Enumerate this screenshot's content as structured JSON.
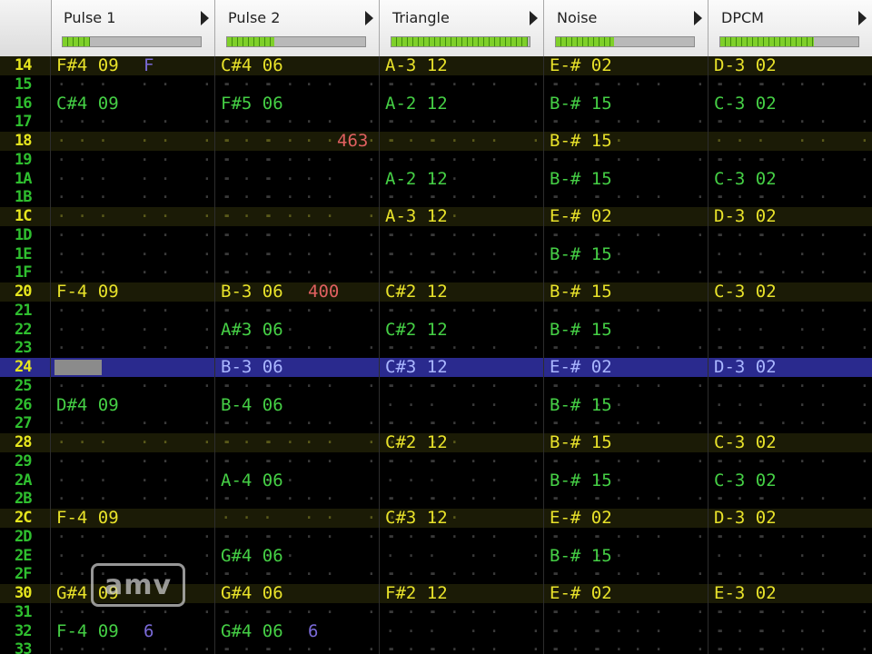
{
  "channels": [
    {
      "name": "Pulse 1",
      "vu_level": 0.2
    },
    {
      "name": "Pulse 2",
      "vu_level": 0.34
    },
    {
      "name": "Triangle",
      "vu_level": 0.99
    },
    {
      "name": "Noise",
      "vu_level": 0.42
    },
    {
      "name": "DPCM",
      "vu_level": 0.68
    }
  ],
  "rows": [
    {
      "num": "14",
      "hl": true,
      "cells": [
        {
          "note": "F#4",
          "vol": "09",
          "fx": "F",
          "fx_color": "purple"
        },
        {
          "note": "C#4",
          "vol": "06"
        },
        {
          "note": "A-3",
          "vol": "12"
        },
        {
          "note": "E-#",
          "vol": "02"
        },
        {
          "note": "D-3",
          "vol": "02"
        }
      ]
    },
    {
      "num": "15",
      "cells": [
        {},
        {},
        {},
        {},
        {}
      ]
    },
    {
      "num": "16",
      "cells": [
        {
          "note": "C#4",
          "vol": "09"
        },
        {
          "note": "F#5",
          "vol": "06"
        },
        {
          "note": "A-2",
          "vol": "12"
        },
        {
          "note": "B-#",
          "vol": "15"
        },
        {
          "note": "C-3",
          "vol": "02"
        }
      ]
    },
    {
      "num": "17",
      "cells": [
        {},
        {},
        {},
        {},
        {}
      ]
    },
    {
      "num": "18",
      "hl": true,
      "cells": [
        {},
        {
          "fx": "463",
          "fx_color": "red"
        },
        {},
        {
          "note": "B-#",
          "vol": "15"
        },
        {}
      ]
    },
    {
      "num": "19",
      "cells": [
        {},
        {},
        {},
        {},
        {}
      ]
    },
    {
      "num": "1A",
      "cells": [
        {},
        {},
        {
          "note": "A-2",
          "vol": "12"
        },
        {
          "note": "B-#",
          "vol": "15"
        },
        {
          "note": "C-3",
          "vol": "02"
        }
      ]
    },
    {
      "num": "1B",
      "cells": [
        {},
        {},
        {},
        {},
        {}
      ]
    },
    {
      "num": "1C",
      "hl": true,
      "cells": [
        {},
        {},
        {
          "note": "A-3",
          "vol": "12"
        },
        {
          "note": "E-#",
          "vol": "02"
        },
        {
          "note": "D-3",
          "vol": "02"
        }
      ]
    },
    {
      "num": "1D",
      "cells": [
        {},
        {},
        {},
        {},
        {}
      ]
    },
    {
      "num": "1E",
      "cells": [
        {},
        {},
        {},
        {
          "note": "B-#",
          "vol": "15"
        },
        {}
      ]
    },
    {
      "num": "1F",
      "cells": [
        {},
        {},
        {},
        {},
        {}
      ]
    },
    {
      "num": "20",
      "hl": true,
      "cells": [
        {
          "note": "F-4",
          "vol": "09"
        },
        {
          "note": "B-3",
          "vol": "06",
          "fx": "400",
          "fx_color": "red"
        },
        {
          "note": "C#2",
          "vol": "12"
        },
        {
          "note": "B-#",
          "vol": "15"
        },
        {
          "note": "C-3",
          "vol": "02"
        }
      ]
    },
    {
      "num": "21",
      "cells": [
        {},
        {},
        {},
        {},
        {}
      ]
    },
    {
      "num": "22",
      "cells": [
        {},
        {
          "note": "A#3",
          "vol": "06"
        },
        {
          "note": "C#2",
          "vol": "12"
        },
        {
          "note": "B-#",
          "vol": "15"
        },
        {}
      ]
    },
    {
      "num": "23",
      "cells": [
        {},
        {},
        {},
        {},
        {}
      ]
    },
    {
      "num": "24",
      "hl": true,
      "cursor": true,
      "cells": [
        {},
        {
          "note": "B-3",
          "vol": "06"
        },
        {
          "note": "C#3",
          "vol": "12"
        },
        {
          "note": "E-#",
          "vol": "02"
        },
        {
          "note": "D-3",
          "vol": "02"
        }
      ]
    },
    {
      "num": "25",
      "cells": [
        {},
        {},
        {},
        {},
        {}
      ]
    },
    {
      "num": "26",
      "cells": [
        {
          "note": "D#4",
          "vol": "09"
        },
        {
          "note": "B-4",
          "vol": "06"
        },
        {},
        {
          "note": "B-#",
          "vol": "15"
        },
        {}
      ]
    },
    {
      "num": "27",
      "cells": [
        {},
        {},
        {},
        {},
        {}
      ]
    },
    {
      "num": "28",
      "hl": true,
      "cells": [
        {},
        {},
        {
          "note": "C#2",
          "vol": "12"
        },
        {
          "note": "B-#",
          "vol": "15"
        },
        {
          "note": "C-3",
          "vol": "02"
        }
      ]
    },
    {
      "num": "29",
      "cells": [
        {},
        {},
        {},
        {},
        {}
      ]
    },
    {
      "num": "2A",
      "cells": [
        {},
        {
          "note": "A-4",
          "vol": "06"
        },
        {},
        {
          "note": "B-#",
          "vol": "15"
        },
        {
          "note": "C-3",
          "vol": "02"
        }
      ]
    },
    {
      "num": "2B",
      "cells": [
        {},
        {},
        {},
        {},
        {}
      ]
    },
    {
      "num": "2C",
      "hl": true,
      "cells": [
        {
          "note": "F-4",
          "vol": "09"
        },
        {},
        {
          "note": "C#3",
          "vol": "12"
        },
        {
          "note": "E-#",
          "vol": "02"
        },
        {
          "note": "D-3",
          "vol": "02"
        }
      ]
    },
    {
      "num": "2D",
      "cells": [
        {},
        {},
        {},
        {},
        {}
      ]
    },
    {
      "num": "2E",
      "cells": [
        {},
        {
          "note": "G#4",
          "vol": "06"
        },
        {},
        {
          "note": "B-#",
          "vol": "15"
        },
        {}
      ]
    },
    {
      "num": "2F",
      "cells": [
        {},
        {},
        {},
        {},
        {}
      ]
    },
    {
      "num": "30",
      "hl": true,
      "cells": [
        {
          "note": "G#4",
          "vol": "09"
        },
        {
          "note": "G#4",
          "vol": "06"
        },
        {
          "note": "F#2",
          "vol": "12"
        },
        {
          "note": "E-#",
          "vol": "02"
        },
        {
          "note": "E-3",
          "vol": "02"
        }
      ]
    },
    {
      "num": "31",
      "cells": [
        {},
        {},
        {},
        {},
        {}
      ]
    },
    {
      "num": "32",
      "cells": [
        {
          "note": "F-4",
          "vol": "09",
          "fx": "6",
          "fx_color": "purple"
        },
        {
          "note": "G#4",
          "vol": "06",
          "fx": "6",
          "fx_color": "purple"
        },
        {},
        {},
        {}
      ]
    },
    {
      "num": "33",
      "cells": [
        {},
        {},
        {},
        {},
        {}
      ]
    }
  ],
  "watermark": "amv",
  "colors": {
    "row_number": "#2fbf2f",
    "highlight_row_number": "#e6e61e",
    "cursor_row": "#2a2a8e",
    "note": "#45cf45",
    "highlight_note": "#e8e22a",
    "fx_red": "#e06060",
    "fx_purple": "#7a6ad8"
  }
}
